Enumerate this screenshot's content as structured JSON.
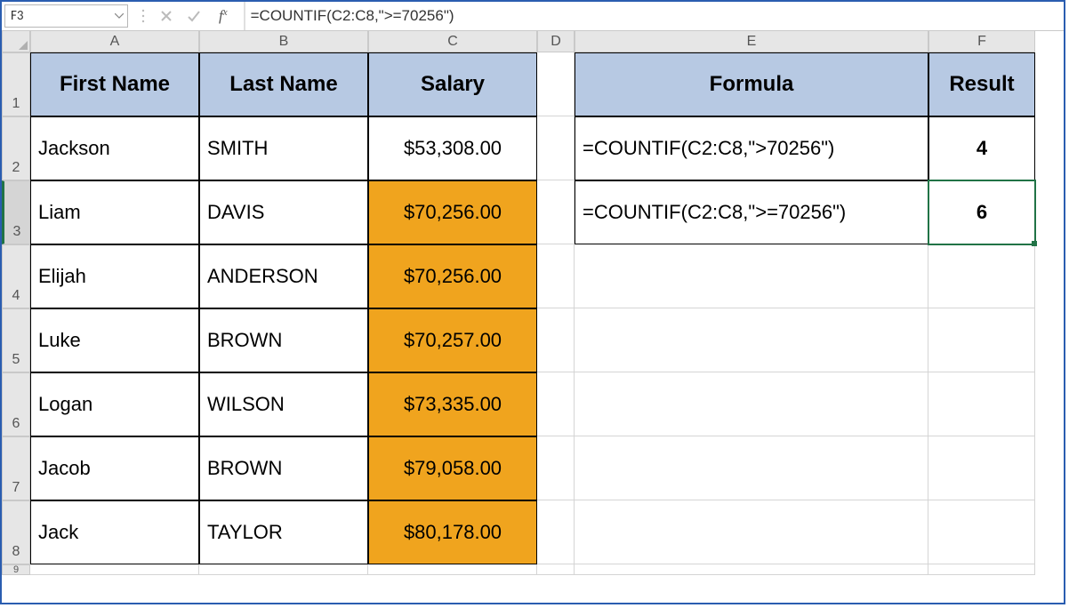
{
  "namebox": "F3",
  "formula_bar": "=COUNTIF(C2:C8,\">=70256\")",
  "columns": [
    "A",
    "B",
    "C",
    "D",
    "E",
    "F"
  ],
  "row_numbers": [
    "1",
    "2",
    "3",
    "4",
    "5",
    "6",
    "7",
    "8",
    "9"
  ],
  "headers": {
    "first_name": "First Name",
    "last_name": "Last Name",
    "salary": "Salary",
    "formula": "Formula",
    "result": "Result"
  },
  "data_rows": [
    {
      "first": "Jackson",
      "last": "SMITH",
      "salary": "$53,308.00",
      "gold": false
    },
    {
      "first": "Liam",
      "last": "DAVIS",
      "salary": "$70,256.00",
      "gold": true
    },
    {
      "first": "Elijah",
      "last": "ANDERSON",
      "salary": "$70,256.00",
      "gold": true
    },
    {
      "first": "Luke",
      "last": "BROWN",
      "salary": "$70,257.00",
      "gold": true
    },
    {
      "first": "Logan",
      "last": "WILSON",
      "salary": "$73,335.00",
      "gold": true
    },
    {
      "first": "Jacob",
      "last": "BROWN",
      "salary": "$79,058.00",
      "gold": true
    },
    {
      "first": "Jack",
      "last": "TAYLOR",
      "salary": "$80,178.00",
      "gold": true
    }
  ],
  "formula_rows": [
    {
      "formula": "=COUNTIF(C2:C8,\">70256\")",
      "result": "4"
    },
    {
      "formula": "=COUNTIF(C2:C8,\">=70256\")",
      "result": "6"
    }
  ],
  "chart_data": {
    "type": "table",
    "title": "",
    "columns": [
      "First Name",
      "Last Name",
      "Salary"
    ],
    "rows": [
      [
        "Jackson",
        "SMITH",
        53308.0
      ],
      [
        "Liam",
        "DAVIS",
        70256.0
      ],
      [
        "Elijah",
        "ANDERSON",
        70256.0
      ],
      [
        "Luke",
        "BROWN",
        70257.0
      ],
      [
        "Logan",
        "WILSON",
        73335.0
      ],
      [
        "Jacob",
        "BROWN",
        79058.0
      ],
      [
        "Jack",
        "TAYLOR",
        80178.0
      ]
    ],
    "formulas": [
      {
        "expr": "=COUNTIF(C2:C8,\">70256\")",
        "result": 4
      },
      {
        "expr": "=COUNTIF(C2:C8,\">=70256\")",
        "result": 6
      }
    ]
  }
}
